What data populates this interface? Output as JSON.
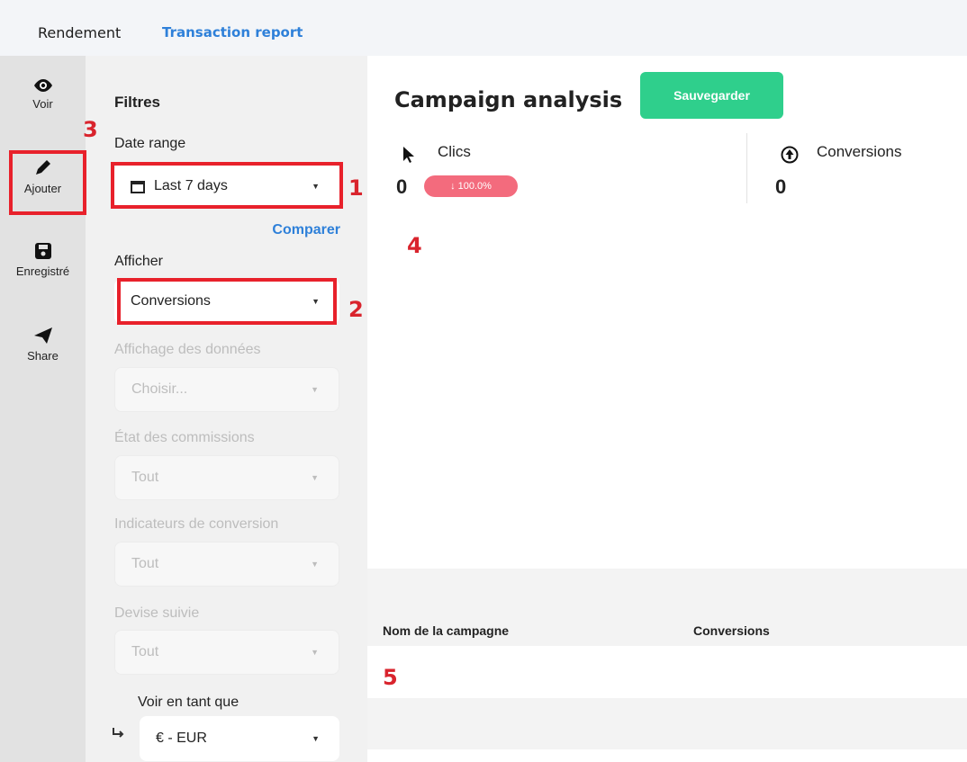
{
  "tabs": [
    {
      "label": "Rendement"
    },
    {
      "label": "Transaction report"
    }
  ],
  "sidebar": {
    "items": [
      {
        "label": "Voir",
        "icon": "eye-icon"
      },
      {
        "label": "Ajouter",
        "icon": "pencil-icon"
      },
      {
        "label": "Enregistré",
        "icon": "floppy-disk-icon"
      },
      {
        "label": "Share",
        "icon": "paper-plane-icon"
      }
    ]
  },
  "filters": {
    "title": "Filtres",
    "date_range": {
      "label": "Date range",
      "value": "Last 7 days"
    },
    "compare_label": "Comparer",
    "afficher": {
      "label": "Afficher",
      "value": "Conversions"
    },
    "affichage": {
      "label": "Affichage des données",
      "placeholder": "Choisir..."
    },
    "etat": {
      "label": "État des commissions",
      "value": "Tout"
    },
    "indicateurs": {
      "label": "Indicateurs de conversion",
      "value": "Tout"
    },
    "devise": {
      "label": "Devise suivie",
      "value": "Tout"
    },
    "voir_en_tant_que": {
      "label": "Voir en tant que",
      "value": "€ - EUR"
    }
  },
  "main": {
    "title": "Campaign analysis",
    "save_label": "Sauvegarder",
    "kpis": [
      {
        "label": "Clics",
        "value": "0",
        "badge": "↓ 100.0%"
      },
      {
        "label": "Conversions",
        "value": "0"
      }
    ],
    "table": {
      "headers": [
        "Nom de la campagne",
        "Conversions"
      ]
    }
  },
  "annotations": [
    "1",
    "2",
    "3",
    "4",
    "5"
  ],
  "colors": {
    "accent_blue": "#2e80d9",
    "save_green": "#2fcf8c",
    "badge_red": "#f36b7d",
    "annotation_red": "#e8212b"
  }
}
